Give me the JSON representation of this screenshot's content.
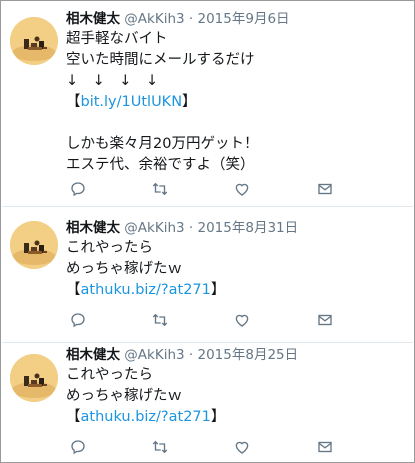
{
  "tweets": [
    {
      "name": "相木健太",
      "handle": "@AkKih3",
      "separator": "·",
      "date": "2015年9月6日",
      "lines": [
        "超手軽なバイト",
        "空いた時間にメールするだけ",
        "↓　↓　↓　↓"
      ],
      "link_prefix": "【",
      "link_text": "bit.ly/1UtlUKN",
      "link_suffix": "】",
      "lines_after": [
        "",
        "しかも楽々月20万円ゲット！",
        "エステ代、余裕ですよ（笑）"
      ]
    },
    {
      "name": "相木健太",
      "handle": "@AkKih3",
      "separator": "·",
      "date": "2015年8月31日",
      "lines": [
        "これやったら",
        "めっちゃ稼げたｗ"
      ],
      "link_prefix": "【",
      "link_text": "athuku.biz/?at271",
      "link_suffix": "】"
    },
    {
      "name": "相木健太",
      "handle": "@AkKih3",
      "separator": "·",
      "date": "2015年8月25日",
      "lines": [
        "これやったら",
        "めっちゃ稼げたｗ"
      ],
      "link_prefix": "【",
      "link_text": "athuku.biz/?at271",
      "link_suffix": "】"
    }
  ],
  "icons": {
    "reply": "reply-icon",
    "retweet": "retweet-icon",
    "like": "heart-icon",
    "dm": "envelope-icon"
  },
  "colors": {
    "link": "#1b95e0",
    "meta": "#657786",
    "avatar_bg": "#f3ce85"
  }
}
